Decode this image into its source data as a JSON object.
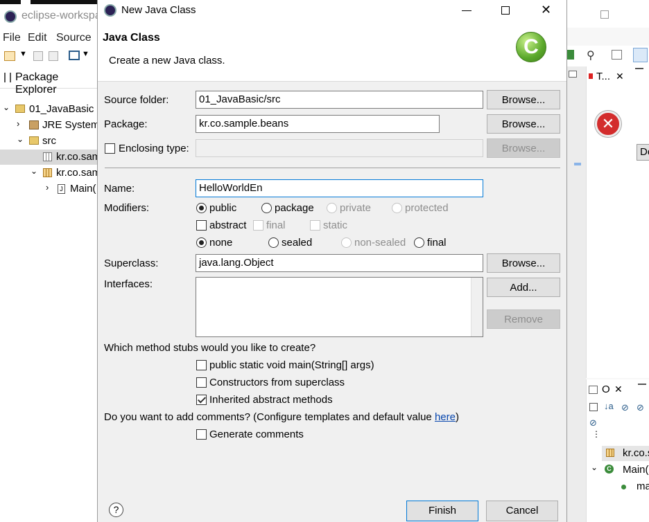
{
  "background_window": {
    "title": "eclipse-workspa",
    "menu": [
      "File",
      "Edit",
      "Source"
    ],
    "package_explorer_tab": "Package Explorer",
    "tree": [
      {
        "label": "01_JavaBasic",
        "indent": 0
      },
      {
        "label": "JRE System",
        "indent": 1
      },
      {
        "label": "src",
        "indent": 1
      },
      {
        "label": "kr.co.sam",
        "indent": 2,
        "selected": true
      },
      {
        "label": "kr.co.sam",
        "indent": 2
      },
      {
        "label": "Main(",
        "indent": 3
      }
    ],
    "right_panel": {
      "tab_t": "T...",
      "tab_o": "O",
      "button_de": "De",
      "outline_items": [
        "kr.co.s",
        "Main(",
        "ma"
      ]
    }
  },
  "dialog": {
    "title": "New Java Class",
    "header_title": "Java Class",
    "header_description": "Create a new Java class.",
    "source_folder": {
      "label": "Source folder:",
      "value": "01_JavaBasic/src",
      "browse": "Browse..."
    },
    "package": {
      "label": "Package:",
      "value": "kr.co.sample.beans",
      "browse": "Browse..."
    },
    "enclosing_type": {
      "label": "Enclosing type:",
      "value": "",
      "browse": "Browse..."
    },
    "name": {
      "label": "Name:",
      "value": "HelloWorldEn"
    },
    "modifiers": {
      "label": "Modifiers:",
      "access": [
        "public",
        "package",
        "private",
        "protected"
      ],
      "other": [
        "abstract",
        "final",
        "static"
      ],
      "sealing": [
        "none",
        "sealed",
        "non-sealed",
        "final"
      ]
    },
    "superclass": {
      "label": "Superclass:",
      "value": "java.lang.Object",
      "browse": "Browse..."
    },
    "interfaces": {
      "label": "Interfaces:",
      "add": "Add...",
      "remove": "Remove"
    },
    "stubs": {
      "question": "Which method stubs would you like to create?",
      "options": [
        {
          "label": "public static void main(String[] args)",
          "checked": false
        },
        {
          "label": "Constructors from superclass",
          "checked": false
        },
        {
          "label": "Inherited abstract methods",
          "checked": true
        }
      ]
    },
    "comments": {
      "question": "Do you want to add comments? (Configure templates and default value ",
      "link": "here",
      "question_end": ")",
      "option": "Generate comments"
    },
    "buttons": {
      "finish": "Finish",
      "cancel": "Cancel",
      "help": "?"
    }
  }
}
